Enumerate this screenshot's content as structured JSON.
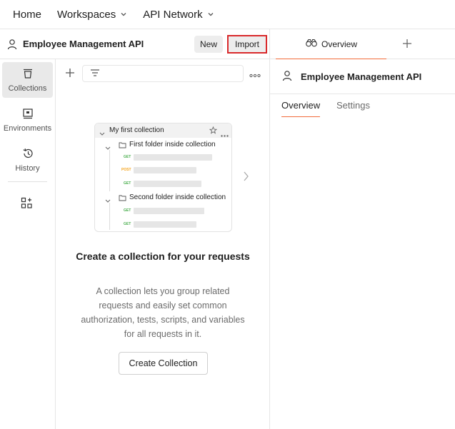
{
  "topnav": {
    "home": "Home",
    "workspaces": "Workspaces",
    "api_network": "API Network"
  },
  "workspace": {
    "name": "Employee Management API",
    "new_label": "New",
    "import_label": "Import"
  },
  "rail": {
    "collections": "Collections",
    "environments": "Environments",
    "history": "History"
  },
  "illustration": {
    "collection": "My first collection",
    "folder1": "First folder inside collection",
    "folder2": "Second folder inside collection",
    "methods": [
      "GET",
      "POST",
      "GET",
      "GET",
      "GET"
    ]
  },
  "empty_state": {
    "title": "Create a collection for your requests",
    "description": "A collection lets you group related requests and easily set common authorization, tests, scripts, and variables for all requests in it.",
    "button": "Create Collection"
  },
  "right_panel": {
    "tab_label": "Overview",
    "title": "Employee Management API",
    "subtabs": [
      "Overview",
      "Settings"
    ]
  },
  "colors": {
    "accent": "#f26b3a",
    "highlight_border": "#d9292b",
    "get": "#4caf50",
    "post": "#f5a623"
  }
}
